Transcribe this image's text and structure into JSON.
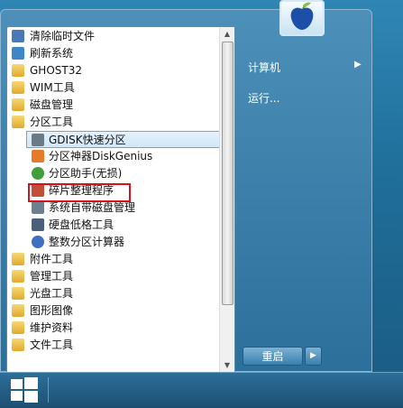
{
  "start_menu": {
    "programs": [
      {
        "label": "清除临时文件",
        "icon": "broom-icon",
        "level": "top"
      },
      {
        "label": "刷新系统",
        "icon": "refresh-icon",
        "level": "top"
      },
      {
        "label": "GHOST32",
        "icon": "folder-icon",
        "level": "top"
      },
      {
        "label": "WIM工具",
        "icon": "folder-icon",
        "level": "top"
      },
      {
        "label": "磁盘管理",
        "icon": "folder-icon",
        "level": "top"
      },
      {
        "label": "分区工具",
        "icon": "folder-icon",
        "level": "top"
      },
      {
        "label": "GDISK快速分区",
        "icon": "disk-icon",
        "level": "sub",
        "selected": true
      },
      {
        "label": "分区神器DiskGenius",
        "icon": "diskgenius-icon",
        "level": "sub"
      },
      {
        "label": "分区助手(无损)",
        "icon": "partition-assistant-icon",
        "level": "sub",
        "highlighted": true
      },
      {
        "label": "碎片整理程序",
        "icon": "defrag-icon",
        "level": "sub"
      },
      {
        "label": "系统自带磁盘管理",
        "icon": "disk-management-icon",
        "level": "sub"
      },
      {
        "label": "硬盘低格工具",
        "icon": "format-icon",
        "level": "sub"
      },
      {
        "label": "整数分区计算器",
        "icon": "calculator-icon",
        "level": "sub"
      },
      {
        "label": "附件工具",
        "icon": "folder-icon",
        "level": "top"
      },
      {
        "label": "管理工具",
        "icon": "folder-icon",
        "level": "top"
      },
      {
        "label": "光盘工具",
        "icon": "folder-icon",
        "level": "top"
      },
      {
        "label": "图形图像",
        "icon": "folder-icon",
        "level": "top"
      },
      {
        "label": "维护资料",
        "icon": "folder-icon",
        "level": "top"
      },
      {
        "label": "文件工具",
        "icon": "folder-icon",
        "level": "top"
      }
    ],
    "right_items": {
      "computer": "计算机",
      "run": "运行..."
    },
    "restart_label": "重启"
  },
  "colors": {
    "highlight_border": "#d8121b",
    "selected_bg": "#d2e7f8"
  }
}
